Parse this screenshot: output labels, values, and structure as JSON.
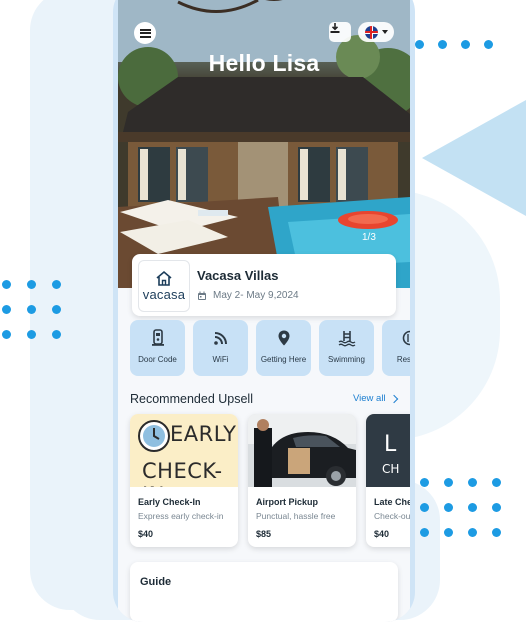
{
  "greeting": "Hello Lisa",
  "hero": {
    "pager": "1/3"
  },
  "property": {
    "logo_text": "vacasa",
    "name": "Vacasa Villas",
    "dates": "May 2- May 9,2024"
  },
  "quick_actions": [
    {
      "label": "Door Code",
      "icon": "door-lock-icon"
    },
    {
      "label": "WiFi",
      "icon": "wifi-icon"
    },
    {
      "label": "Getting Here",
      "icon": "map-pin-icon"
    },
    {
      "label": "Swimming",
      "icon": "swimming-icon"
    },
    {
      "label": "Restau",
      "icon": "restaurant-icon"
    }
  ],
  "upsell": {
    "title": "Recommended Upsell",
    "view_all": "View all",
    "items": [
      {
        "image_text_1": "EARLY",
        "image_text_2": "CHECK-IN",
        "title": "Early Check-In",
        "description": "Express early check-in",
        "price": "$40"
      },
      {
        "title": "Airport Pickup",
        "description": "Punctual, hassle free",
        "price": "$85"
      },
      {
        "image_text": "L",
        "image_text_2": "CH",
        "title": "Late Che",
        "description": "Check-ou",
        "price": "$40"
      }
    ]
  },
  "guide": {
    "title": "Guide"
  },
  "colors": {
    "accent": "#1d7fd0",
    "tile_bg": "#c8e1f6",
    "dots": "#1d9be3"
  }
}
